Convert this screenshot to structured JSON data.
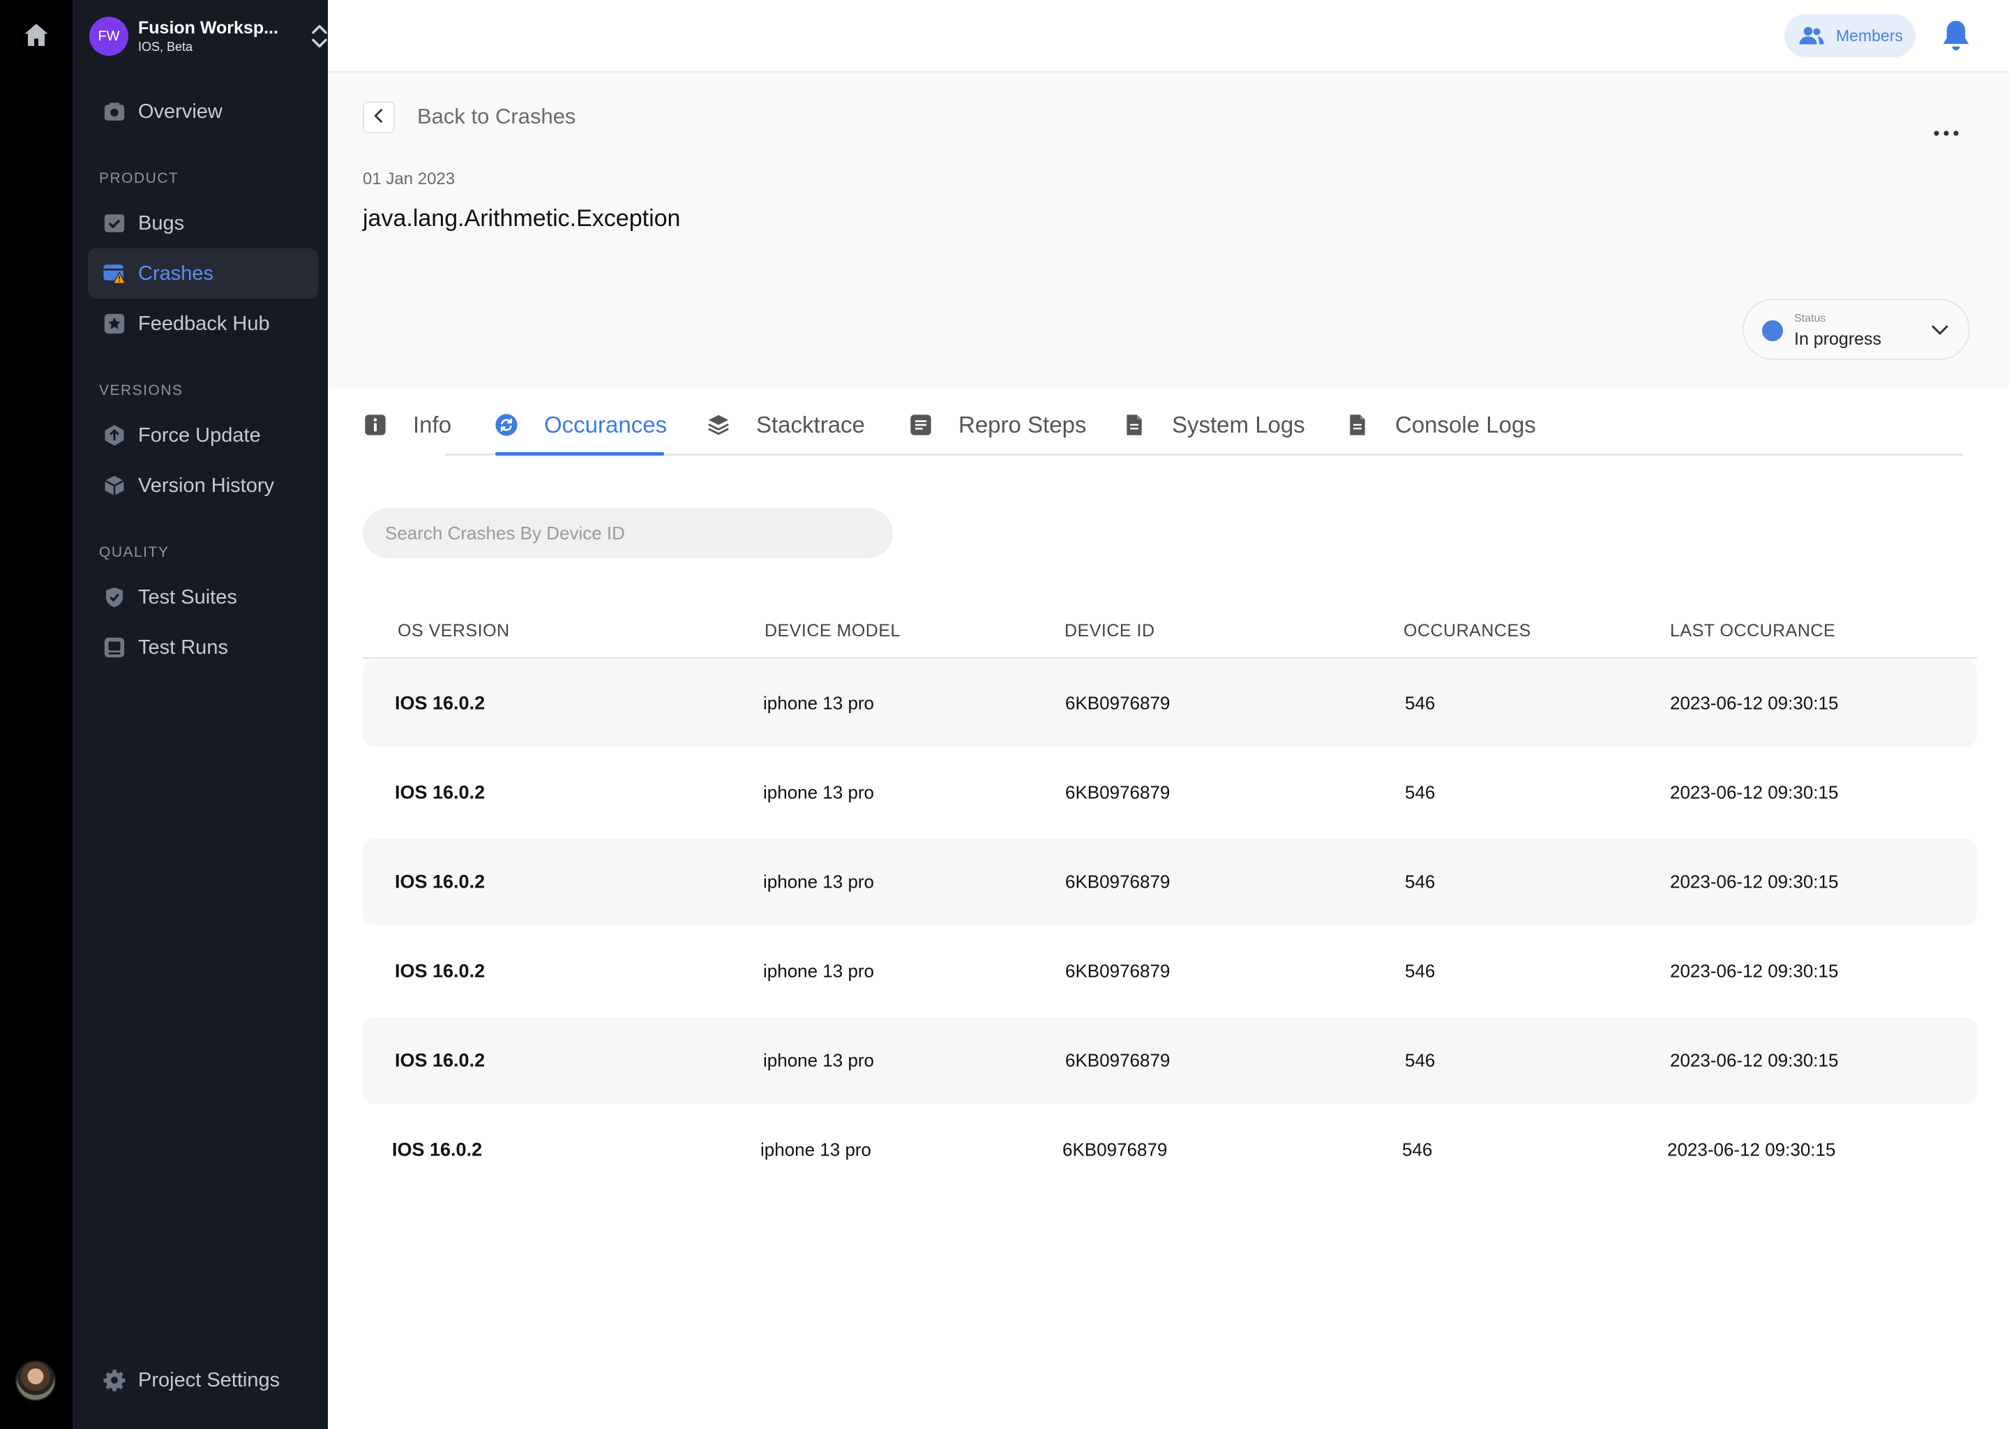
{
  "workspace": {
    "initials": "FW",
    "name": "Fusion Worksp...",
    "subtitle": "IOS, Beta"
  },
  "sidebar": {
    "overview": "Overview",
    "sections": {
      "product": "PRODUCT",
      "versions": "VERSIONS",
      "quality": "QUALITY"
    },
    "items": {
      "bugs": "Bugs",
      "crashes": "Crashes",
      "feedback_hub": "Feedback Hub",
      "force_update": "Force Update",
      "version_history": "Version History",
      "test_suites": "Test Suites",
      "test_runs": "Test Runs"
    },
    "project_settings": "Project Settings",
    "active": "crashes"
  },
  "topbar": {
    "members_label": "Members"
  },
  "header": {
    "back_label": "Back to Crashes",
    "date": "01 Jan 2023",
    "title": "java.lang.Arithmetic.Exception",
    "status_label": "Status",
    "status_value": "In progress",
    "status_color": "#4a7fe0"
  },
  "tabs": [
    {
      "label": "Info",
      "icon": "info-icon"
    },
    {
      "label": "Occurances",
      "icon": "refresh-icon",
      "active": true
    },
    {
      "label": "Stacktrace",
      "icon": "layers-icon"
    },
    {
      "label": "Repro Steps",
      "icon": "list-icon"
    },
    {
      "label": "System Logs",
      "icon": "document-icon"
    },
    {
      "label": "Console Logs",
      "icon": "document-icon"
    }
  ],
  "search": {
    "placeholder": "Search Crashes By Device ID",
    "value": ""
  },
  "table": {
    "columns": [
      "OS VERSION",
      "DEVICE MODEL",
      "DEVICE ID",
      "OCCURANCES",
      "LAST OCCURANCE"
    ],
    "rows": [
      {
        "os": "IOS 16.0.2",
        "model": "iphone 13 pro",
        "device_id": "6KB0976879",
        "occurances": "546",
        "last": "2023-06-12 09:30:15"
      },
      {
        "os": "IOS 16.0.2",
        "model": "iphone 13 pro",
        "device_id": "6KB0976879",
        "occurances": "546",
        "last": "2023-06-12 09:30:15"
      },
      {
        "os": "IOS 16.0.2",
        "model": "iphone 13 pro",
        "device_id": "6KB0976879",
        "occurances": "546",
        "last": "2023-06-12 09:30:15"
      },
      {
        "os": "IOS 16.0.2",
        "model": "iphone 13 pro",
        "device_id": "6KB0976879",
        "occurances": "546",
        "last": "2023-06-12 09:30:15"
      },
      {
        "os": "IOS 16.0.2",
        "model": "iphone 13 pro",
        "device_id": "6KB0976879",
        "occurances": "546",
        "last": "2023-06-12 09:30:15"
      },
      {
        "os": "IOS 16.0.2",
        "model": "iphone 13 pro",
        "device_id": "6KB0976879",
        "occurances": "546",
        "last": "2023-06-12 09:30:15"
      }
    ]
  },
  "colors": {
    "accent": "#3f7be3",
    "sidebar_bg": "#161a22",
    "rail_bg": "#000000",
    "workspace_logo": "#7c3aed"
  }
}
